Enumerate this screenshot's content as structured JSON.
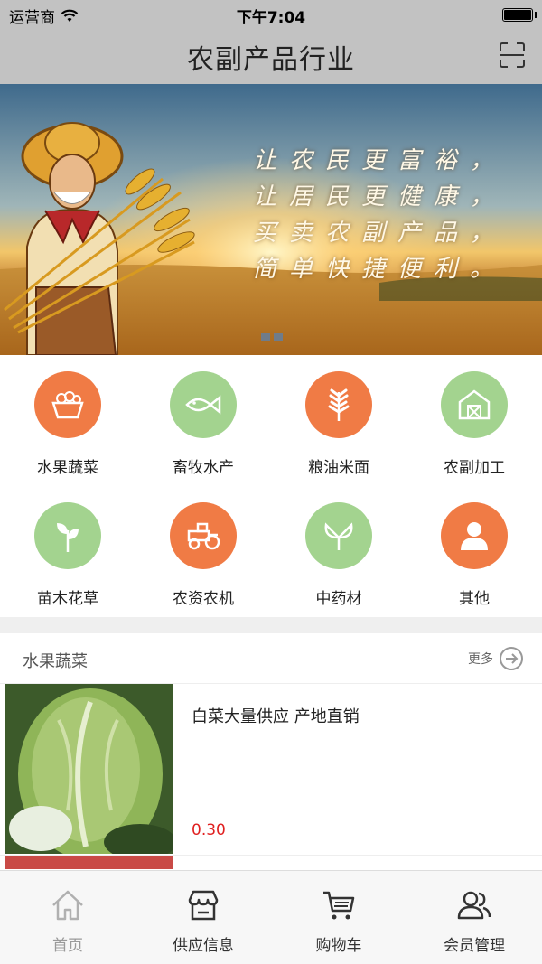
{
  "status_bar": {
    "carrier": "运营商",
    "time": "下午7:04"
  },
  "nav": {
    "title": "农副产品行业",
    "scan_icon": "scan-icon"
  },
  "banner": {
    "lines": [
      "让农民更富裕，",
      "让居民更健康，",
      "买卖农副产品，",
      "简单快捷便利。"
    ],
    "slide_count": 2
  },
  "categories": [
    {
      "label": "水果蔬菜",
      "icon": "fruit-basket-icon",
      "color": "#f07b45"
    },
    {
      "label": "畜牧水产",
      "icon": "fish-icon",
      "color": "#a3d38f"
    },
    {
      "label": "粮油米面",
      "icon": "wheat-icon",
      "color": "#f07b45"
    },
    {
      "label": "农副加工",
      "icon": "barn-icon",
      "color": "#a3d38f"
    },
    {
      "label": "苗木花草",
      "icon": "sprout-icon",
      "color": "#a3d38f"
    },
    {
      "label": "农资农机",
      "icon": "tractor-icon",
      "color": "#f07b45"
    },
    {
      "label": "中药材",
      "icon": "ginkgo-leaf-icon",
      "color": "#a3d38f"
    },
    {
      "label": "其他",
      "icon": "person-icon",
      "color": "#f07b45"
    }
  ],
  "section": {
    "title": "水果蔬菜",
    "more_label": "更多"
  },
  "products": [
    {
      "name": "白菜大量供应 产地直销",
      "price": "0.30",
      "image": "cabbage-photo"
    }
  ],
  "tabs": [
    {
      "label": "首页",
      "icon": "home-icon",
      "active": true
    },
    {
      "label": "供应信息",
      "icon": "store-icon",
      "active": false
    },
    {
      "label": "购物车",
      "icon": "cart-icon",
      "active": false
    },
    {
      "label": "会员管理",
      "icon": "members-icon",
      "active": false
    }
  ]
}
